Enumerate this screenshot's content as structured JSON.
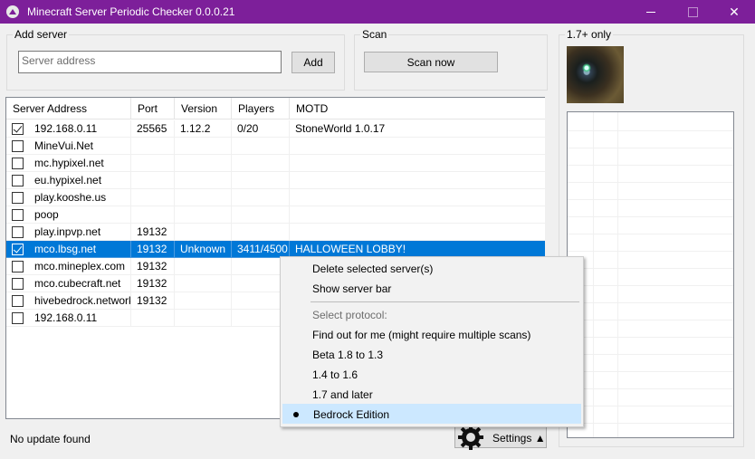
{
  "window": {
    "title": "Minecraft Server Periodic Checker 0.0.0.21",
    "minimize": "",
    "maximize": "",
    "close": "✕"
  },
  "add_server": {
    "group_label": "Add server",
    "address_placeholder": "Server address",
    "add_button": "Add"
  },
  "scan": {
    "group_label": "Scan",
    "scan_button": "Scan now"
  },
  "right_panel": {
    "label": "1.7+ only"
  },
  "server_list": {
    "columns": [
      "Server Address",
      "Port",
      "Version",
      "Players",
      "MOTD"
    ],
    "rows": [
      {
        "checked": true,
        "address": "192.168.0.11",
        "port": "25565",
        "version": "1.12.2",
        "players": "0/20",
        "motd": "StoneWorld 1.0.17",
        "selected": false
      },
      {
        "checked": false,
        "address": "MineVui.Net",
        "port": "",
        "version": "",
        "players": "",
        "motd": "",
        "selected": false
      },
      {
        "checked": false,
        "address": "mc.hypixel.net",
        "port": "",
        "version": "",
        "players": "",
        "motd": "",
        "selected": false
      },
      {
        "checked": false,
        "address": "eu.hypixel.net",
        "port": "",
        "version": "",
        "players": "",
        "motd": "",
        "selected": false
      },
      {
        "checked": false,
        "address": "play.kooshe.us",
        "port": "",
        "version": "",
        "players": "",
        "motd": "",
        "selected": false
      },
      {
        "checked": false,
        "address": "poop",
        "port": "",
        "version": "",
        "players": "",
        "motd": "",
        "selected": false
      },
      {
        "checked": false,
        "address": "play.inpvp.net",
        "port": "19132",
        "version": "",
        "players": "",
        "motd": "",
        "selected": false
      },
      {
        "checked": true,
        "address": "mco.lbsg.net",
        "port": "19132",
        "version": "Unknown",
        "players": "3411/4500",
        "motd": "HALLOWEEN LOBBY!",
        "selected": true
      },
      {
        "checked": false,
        "address": "mco.mineplex.com",
        "port": "19132",
        "version": "",
        "players": "",
        "motd": "",
        "selected": false
      },
      {
        "checked": false,
        "address": "mco.cubecraft.net",
        "port": "19132",
        "version": "",
        "players": "",
        "motd": "",
        "selected": false
      },
      {
        "checked": false,
        "address": "hivebedrock.network",
        "port": "19132",
        "version": "",
        "players": "",
        "motd": "",
        "selected": false
      },
      {
        "checked": false,
        "address": "192.168.0.11",
        "port": "",
        "version": "",
        "players": "",
        "motd": "",
        "selected": false
      }
    ]
  },
  "context_menu": {
    "delete": "Delete selected server(s)",
    "show_bar": "Show server bar",
    "select_protocol": "Select protocol:",
    "find_out": "Find out for me (might require multiple scans)",
    "beta": "Beta 1.8 to 1.3",
    "v14": "1.4 to 1.6",
    "v17": "1.7 and later",
    "bedrock": "Bedrock Edition",
    "selected_protocol": "Bedrock Edition"
  },
  "status": {
    "text": "No update found",
    "settings_button": "Settings ▲"
  },
  "colors": {
    "titlebar": "#7d1f9a",
    "selection": "#0078d7",
    "menu_highlight": "#cce8ff"
  }
}
